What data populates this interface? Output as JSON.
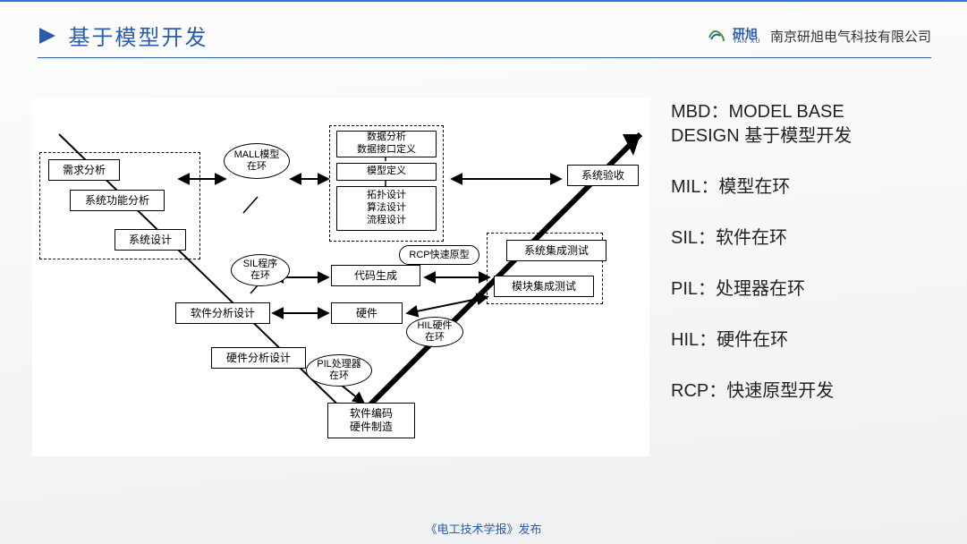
{
  "header": {
    "title": "基于模型开发",
    "brand_cn": "研旭",
    "brand_en": "YAN XU",
    "company": "南京研旭电气科技有限公司"
  },
  "side": {
    "mbd_line1": "MBD：MODEL BASE",
    "mbd_line2": "DESIGN 基于模型开发",
    "mil": "MIL：模型在环",
    "sil": "SIL：软件在环",
    "pil": "PIL：处理器在环",
    "hil": "HIL：硬件在环",
    "rcp": "RCP：快速原型开发"
  },
  "diagram": {
    "req": "需求分析",
    "sysfunc": "系统功能分析",
    "sysdesign": "系统设计",
    "swdesign": "软件分析设计",
    "hwdesign": "硬件分析设计",
    "coding": "软件编码\n硬件制造",
    "hw": "硬件",
    "codegen": "代码生成",
    "dataAnalysis": "数据分析\n数据接口定义",
    "modeldef": "模型定义",
    "topo": "拓扑设计\n算法设计\n流程设计",
    "modtest": "模块集成测试",
    "systest": "系统集成测试",
    "accept": "系统验收",
    "mall": "MALL模型\n在环",
    "sil": "SIL程序\n在环",
    "pil": "PIL处理器\n在环",
    "hil": "HIL硬件\n在环",
    "rcp": "RCP快速原型"
  },
  "footer": "《电工技术学报》发布"
}
